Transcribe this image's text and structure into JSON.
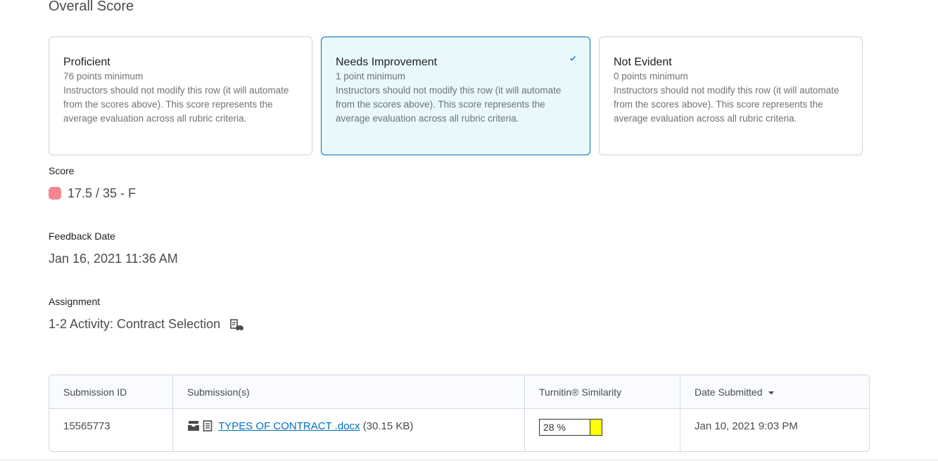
{
  "section_title": "Overall Score",
  "levels": [
    {
      "name": "Proficient",
      "points": "76 points minimum",
      "description": "Instructors should not modify this row (it will automate from the scores above). This score represents the average evaluation across all rubric criteria.",
      "selected": false
    },
    {
      "name": "Needs Improvement",
      "points": "1 point minimum",
      "description": "Instructors should not modify this row (it will automate from the scores above). This score represents the average evaluation across all rubric criteria.",
      "selected": true
    },
    {
      "name": "Not Evident",
      "points": "0 points minimum",
      "description": "Instructors should not modify this row (it will automate from the scores above). This score represents the average evaluation across all rubric criteria.",
      "selected": false
    }
  ],
  "score": {
    "label": "Score",
    "value": "17.5 / 35 - F",
    "swatch_color": "#f4868f"
  },
  "feedback_date": {
    "label": "Feedback Date",
    "value": "Jan 16, 2021 11:36 AM"
  },
  "assignment": {
    "label": "Assignment",
    "value": "1-2 Activity: Contract Selection",
    "icon": "user-availability-icon"
  },
  "submissions_table": {
    "headers": {
      "id": "Submission ID",
      "files": "Submission(s)",
      "similarity": "Turnitin® Similarity",
      "date": "Date Submitted"
    },
    "rows": [
      {
        "id": "15565773",
        "file_name": "TYPES OF CONTRACT .docx",
        "file_size": "(30.15 KB)",
        "similarity": "28 %",
        "similarity_color": "#ffff00",
        "date": "Jan 10, 2021 9:03 PM"
      }
    ]
  },
  "colors": {
    "accent": "#006fbf",
    "selected_bg": "#e8f8fd"
  }
}
